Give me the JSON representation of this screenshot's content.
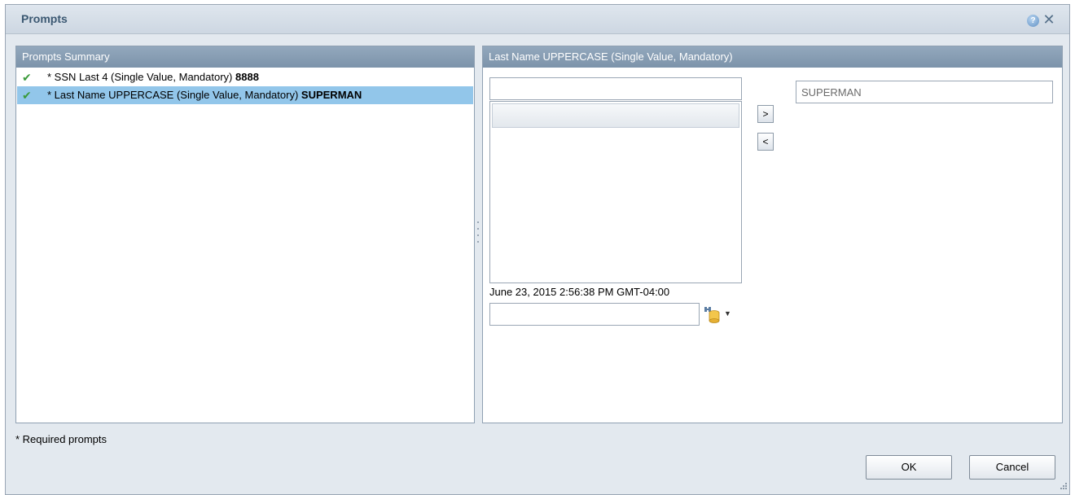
{
  "dialog": {
    "title": "Prompts"
  },
  "summary": {
    "header": "Prompts Summary",
    "items": [
      {
        "label": "* SSN Last 4 (Single Value, Mandatory) ",
        "value": "8888",
        "status": "check-icon"
      },
      {
        "label": "* Last Name UPPERCASE (Single Value, Mandatory) ",
        "value": "SUPERMAN",
        "status": "check-icon"
      }
    ]
  },
  "detail": {
    "header": "Last Name UPPERCASE (Single Value, Mandatory)",
    "search_value": "",
    "add_label": ">",
    "remove_label": "<",
    "selected_value": "SUPERMAN",
    "timestamp": "June 23, 2015 2:56:38 PM GMT-04:00",
    "date_value": ""
  },
  "footer": {
    "required_note": "* Required prompts",
    "ok_label": "OK",
    "cancel_label": "Cancel"
  },
  "colors": {
    "header_bg": "#7f96ad",
    "selection_bg": "#92c6ea",
    "check": "#3b9a3b"
  }
}
